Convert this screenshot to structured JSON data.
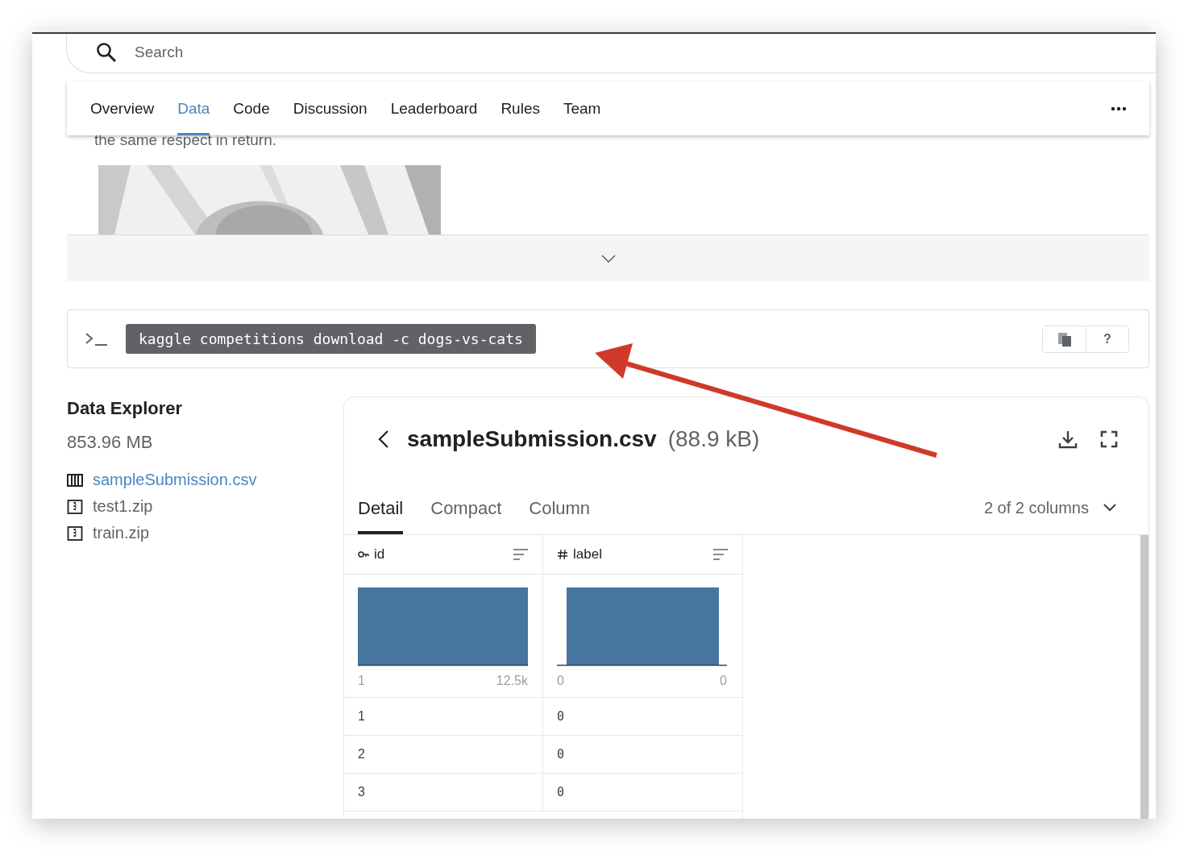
{
  "search": {
    "placeholder": "Search"
  },
  "tabs": [
    {
      "label": "Overview",
      "selected": false
    },
    {
      "label": "Data",
      "selected": true
    },
    {
      "label": "Code",
      "selected": false
    },
    {
      "label": "Discussion",
      "selected": false
    },
    {
      "label": "Leaderboard",
      "selected": false
    },
    {
      "label": "Rules",
      "selected": false
    },
    {
      "label": "Team",
      "selected": false
    }
  ],
  "description": "the same respect in return.",
  "command": {
    "text": "kaggle competitions download -c dogs-vs-cats",
    "help": "?"
  },
  "explorer": {
    "title": "Data Explorer",
    "size": "853.96 MB",
    "files": [
      {
        "name": "sampleSubmission.csv",
        "kind": "table",
        "selected": true
      },
      {
        "name": "test1.zip",
        "kind": "zip",
        "selected": false
      },
      {
        "name": "train.zip",
        "kind": "zip",
        "selected": false
      }
    ]
  },
  "file_panel": {
    "name": "sampleSubmission.csv",
    "size": "(88.9 kB)",
    "view_tabs": [
      {
        "label": "Detail",
        "selected": true
      },
      {
        "label": "Compact",
        "selected": false
      },
      {
        "label": "Column",
        "selected": false
      }
    ],
    "column_count": "2 of 2 columns",
    "columns": [
      {
        "name": "id",
        "kind": "key",
        "hist_min": "1",
        "hist_max": "12.5k"
      },
      {
        "name": "label",
        "kind": "number",
        "hist_min": "0",
        "hist_max": "0"
      }
    ],
    "rows": [
      [
        "1",
        "0"
      ],
      [
        "2",
        "0"
      ],
      [
        "3",
        "0"
      ]
    ]
  }
}
